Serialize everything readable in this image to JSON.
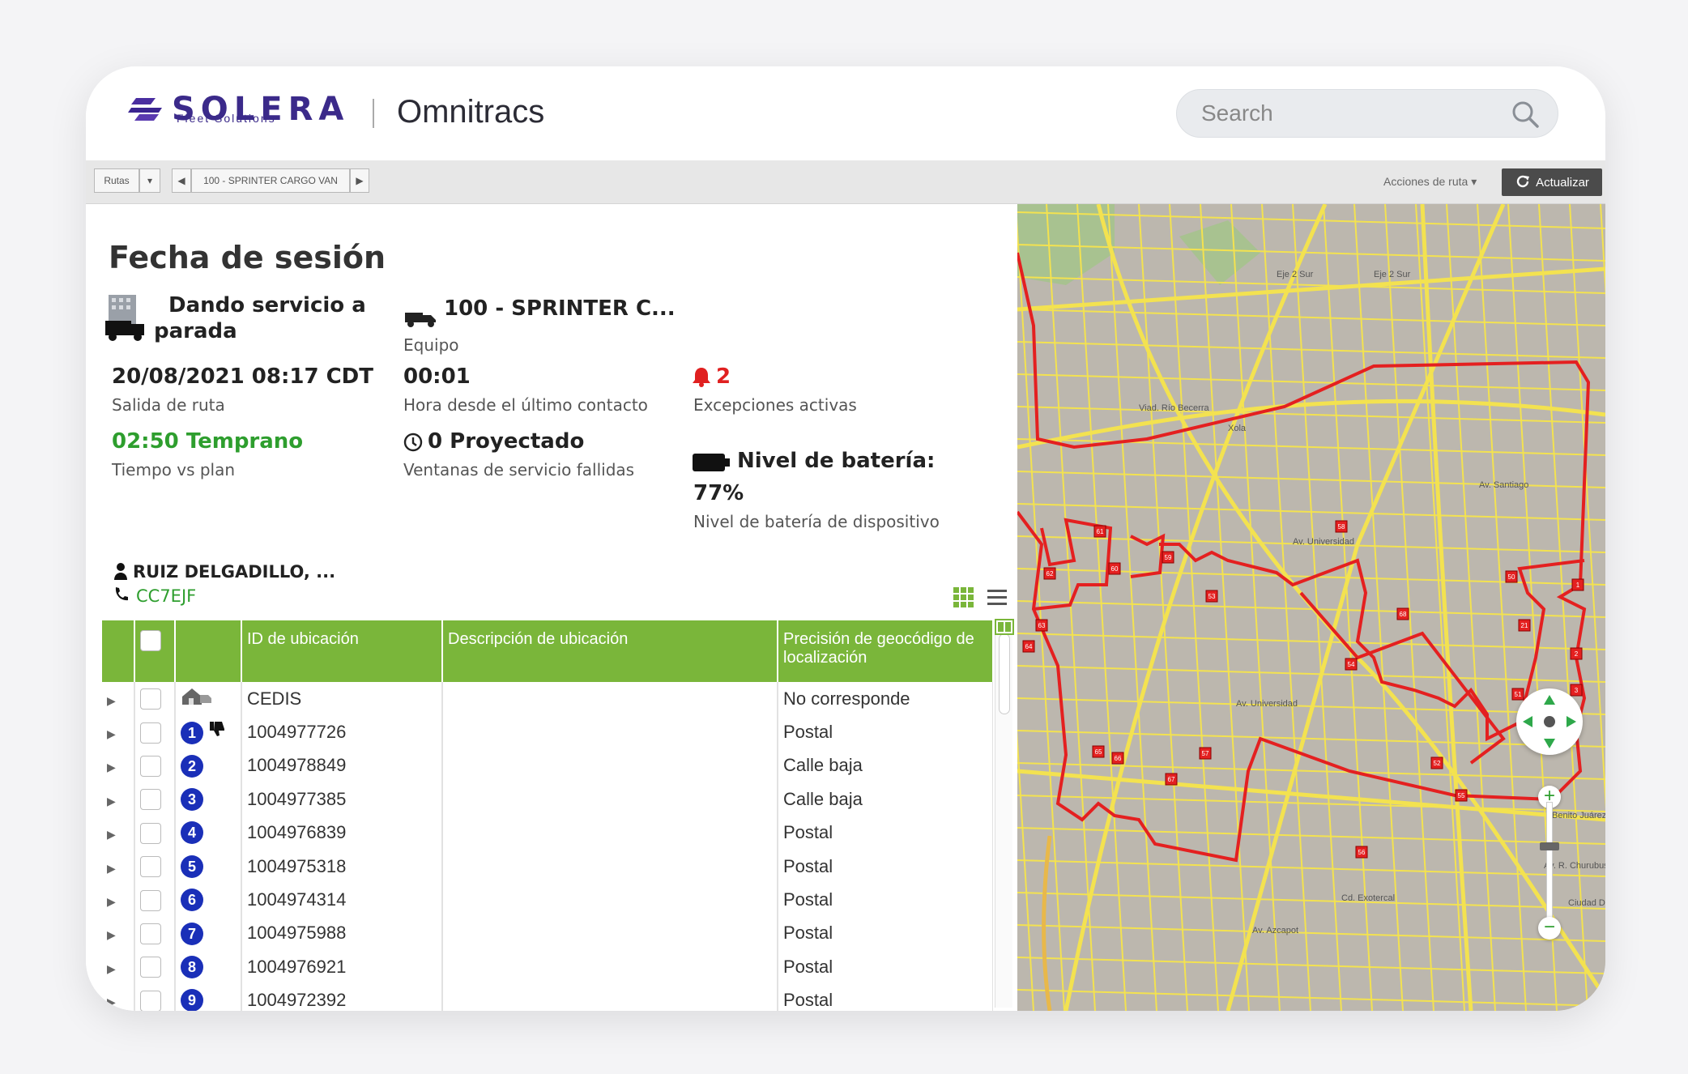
{
  "header": {
    "logo_name": "SOLERA",
    "logo_sub": "Fleet Solutions",
    "brand": "Omnitracs",
    "search_placeholder": "Search"
  },
  "toolbar": {
    "routes_label": "Rutas",
    "vehicle_label": "100 - SPRINTER CARGO VAN",
    "route_actions": "Acciones de ruta",
    "refresh_label": "Actualizar"
  },
  "session": {
    "title": "Fecha de sesión",
    "status_line1": "Dando servicio a",
    "status_line2": "parada",
    "equipment_value": "100 - SPRINTER C...",
    "equipment_label": "Equipo",
    "departure_value": "20/08/2021 08:17 CDT",
    "departure_label": "Salida de ruta",
    "last_contact_value": "00:01",
    "last_contact_label": "Hora desde el último contacto",
    "exceptions_value": "2",
    "exceptions_label": "Excepciones activas",
    "time_vs_plan_value": "02:50 Temprano",
    "time_vs_plan_label": "Tiempo vs plan",
    "failed_windows_value": "0 Proyectado",
    "failed_windows_label": "Ventanas de servicio fallidas",
    "battery_title": "Nivel de batería:",
    "battery_value": "77%",
    "battery_label": "Nivel de batería de dispositivo",
    "driver_name": "RUIZ DELGADILLO, ...",
    "driver_code": "CC7EJF"
  },
  "table": {
    "headers": [
      "ID de ubicación",
      "Descripción de ubicación",
      "Precisión de geocódigo de localización"
    ],
    "rows": [
      {
        "stop": "",
        "id": "CEDIS",
        "desc": "",
        "precision": "No corresponde"
      },
      {
        "stop": "1",
        "id": "1004977726",
        "desc": "",
        "precision": "Postal"
      },
      {
        "stop": "2",
        "id": "1004978849",
        "desc": "",
        "precision": "Calle baja"
      },
      {
        "stop": "3",
        "id": "1004977385",
        "desc": "",
        "precision": "Calle baja"
      },
      {
        "stop": "4",
        "id": "1004976839",
        "desc": "",
        "precision": "Postal"
      },
      {
        "stop": "5",
        "id": "1004975318",
        "desc": "",
        "precision": "Postal"
      },
      {
        "stop": "6",
        "id": "1004974314",
        "desc": "",
        "precision": "Postal"
      },
      {
        "stop": "7",
        "id": "1004975988",
        "desc": "",
        "precision": "Postal"
      },
      {
        "stop": "8",
        "id": "1004976921",
        "desc": "",
        "precision": "Postal"
      },
      {
        "stop": "9",
        "id": "1004972392",
        "desc": "",
        "precision": "Postal"
      }
    ]
  },
  "map": {
    "street_labels": [
      "Eje 2 Sur",
      "Eje 2 Sur",
      "Viad. Río Becerra",
      "Xola",
      "Av. Universidad",
      "Av. Universidad",
      "Av. Santiago",
      "Av. R. Churubusco",
      "Cd. Exotercal",
      "Av. Azcapot",
      "Ciudad De",
      "Benito Juárez"
    ],
    "stop_markers": [
      "1",
      "2",
      "3",
      "21",
      "50",
      "51",
      "52",
      "53",
      "54",
      "55",
      "56",
      "57",
      "58",
      "59",
      "60",
      "61",
      "62",
      "63",
      "64",
      "65",
      "66",
      "67",
      "68"
    ],
    "colors": {
      "route": "#e42020",
      "streets": "#f3e250",
      "land": "#bcb7ae",
      "park": "#a8c290",
      "nav": "#2ea84a"
    }
  }
}
